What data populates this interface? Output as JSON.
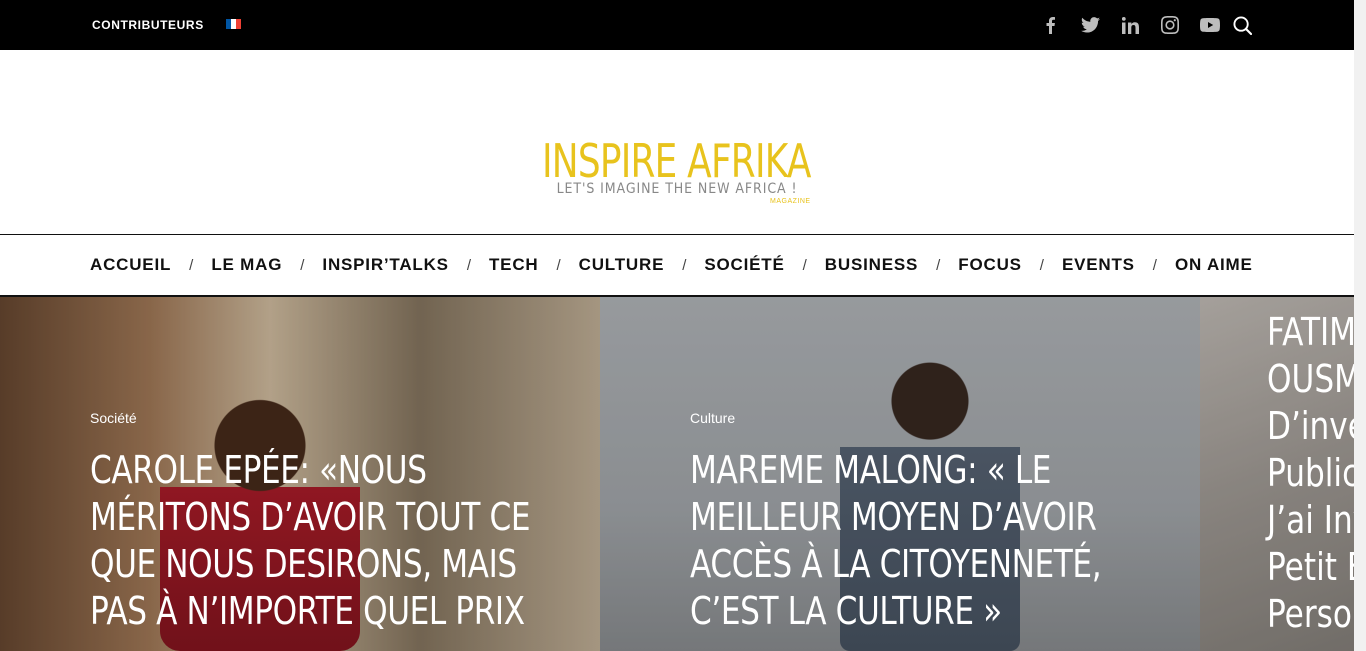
{
  "topbar": {
    "contributors_label": "CONTRIBUTEURS",
    "flag_colors": [
      "#0055a4",
      "#ffffff",
      "#ef4135"
    ],
    "social_icons": [
      "facebook-icon",
      "twitter-icon",
      "linkedin-icon",
      "instagram-icon",
      "youtube-icon"
    ],
    "search_icon": "search-icon"
  },
  "header": {
    "logo_text": "INSPIRE AFRIKA",
    "logo_sub": "MAGAZINE",
    "tagline": "LET'S IMAGINE THE NEW AFRICA !",
    "brand_color": "#e8c31d"
  },
  "nav": {
    "items": [
      {
        "label": "ACCUEIL"
      },
      {
        "label": "LE MAG"
      },
      {
        "label": "INSPIR’TALKS"
      },
      {
        "label": "TECH"
      },
      {
        "label": "CULTURE"
      },
      {
        "label": "SOCIÉTÉ"
      },
      {
        "label": "BUSINESS"
      },
      {
        "label": "FOCUS"
      },
      {
        "label": "EVENTS"
      },
      {
        "label": "ON AIME"
      }
    ],
    "separator": "/"
  },
  "slides": [
    {
      "category": "Société",
      "title_lines": [
        "CAROLE EPÉE: «NOUS",
        "MÉRITONS D’AVOIR TOUT CE",
        "QUE NOUS DESIRONS, MAIS",
        "PAS À N’IMPORTE QUEL PRIX »"
      ]
    },
    {
      "category": "Culture",
      "title_lines": [
        "MAREME MALONG: « LE",
        "MEILLEUR MOYEN D’AVOIR",
        "ACCÈS À LA CITOYENNETÉ,",
        "C’EST LA CULTURE »"
      ]
    },
    {
      "title_lines": [
        "FATIMA",
        "OUSMA",
        "D’inves",
        "Public",
        "J’ai Inv",
        "Petit B",
        "Person"
      ]
    }
  ]
}
